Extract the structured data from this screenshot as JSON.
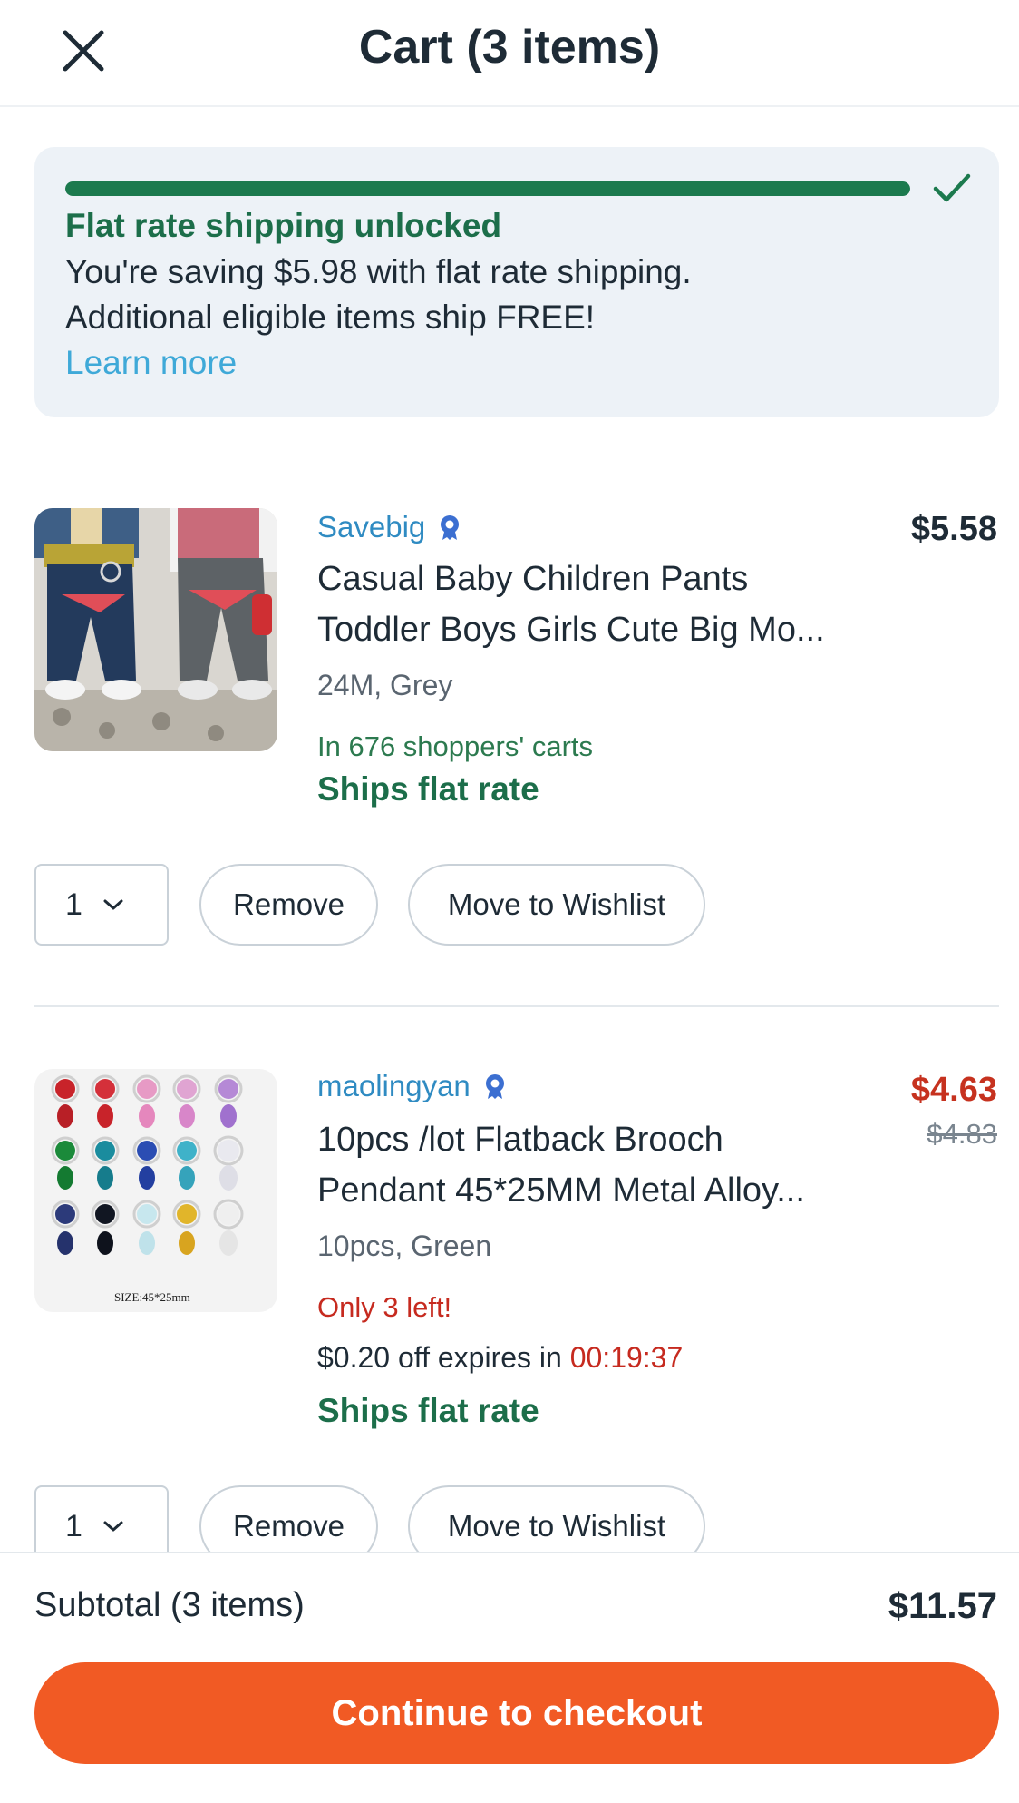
{
  "header": {
    "title": "Cart (3 items)",
    "close_icon": "close-icon"
  },
  "shipping_banner": {
    "progress": 1.0,
    "title": "Flat rate shipping unlocked",
    "line1": "You're saving $5.98 with flat rate shipping.",
    "line2": "Additional eligible items ship FREE!",
    "link": "Learn more",
    "accent_color": "#1c7a4e"
  },
  "items": [
    {
      "store": "Savebig",
      "price": "$5.58",
      "name_line1": "Casual Baby Children Pants",
      "name_line2": "Toddler Boys Girls Cute Big Mo...",
      "variant": "24M, Grey",
      "social": "In 676 shoppers' carts",
      "shipping": "Ships flat rate",
      "quantity": "1",
      "remove_label": "Remove",
      "wishlist_label": "Move to Wishlist"
    },
    {
      "store": "maolingyan",
      "price": "$4.63",
      "original_price": "$4.83",
      "name_line1": "10pcs /lot Flatback Brooch",
      "name_line2": "Pendant 45*25MM Metal Alloy...",
      "variant": "10pcs, Green",
      "stock": "Only 3 left!",
      "discount_prefix": "$0.20 off expires in",
      "discount_timer": "00:19:37",
      "shipping": "Ships flat rate",
      "quantity": "1",
      "remove_label": "Remove",
      "wishlist_label": "Move to Wishlist",
      "image_caption": "SIZE:45*25mm"
    }
  ],
  "footer": {
    "subtotal_label": "Subtotal (3 items)",
    "subtotal_value": "$11.57",
    "checkout_label": "Continue to checkout",
    "checkout_color": "#f15a24"
  }
}
